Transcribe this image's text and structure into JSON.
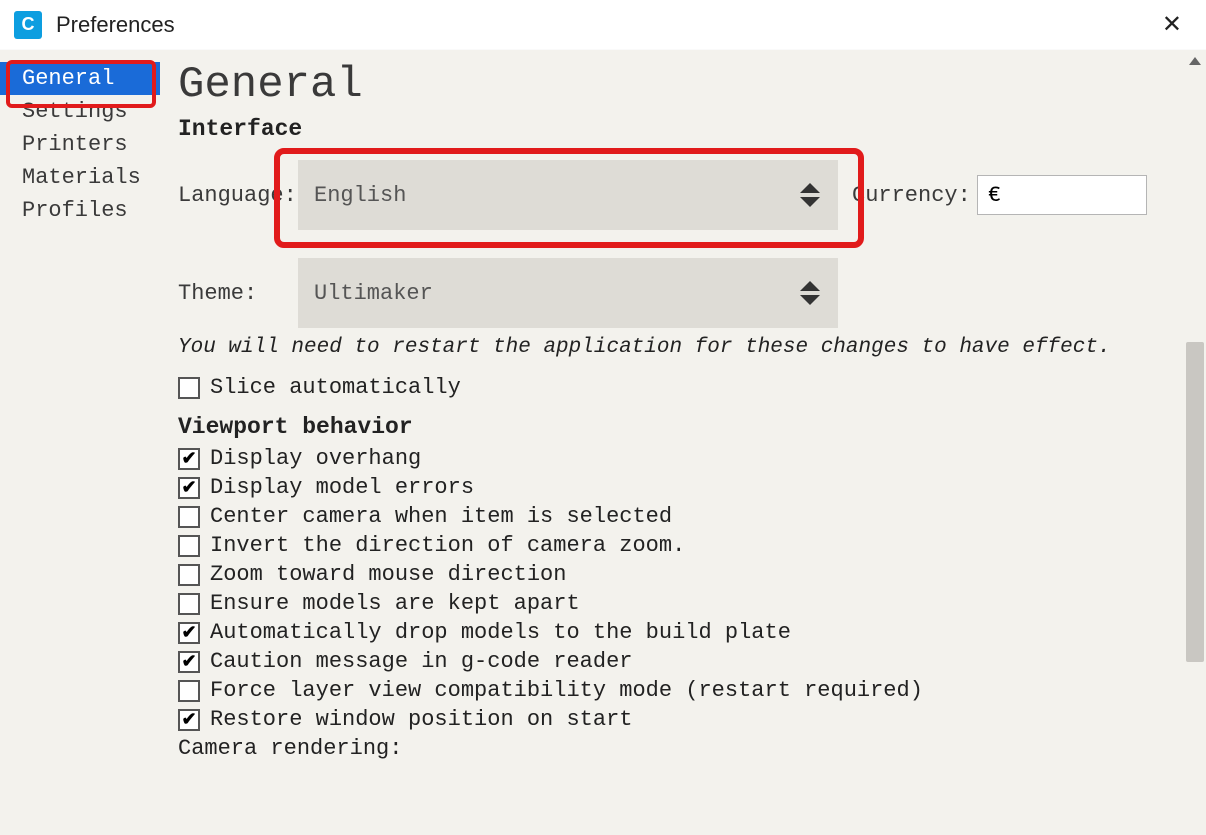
{
  "window": {
    "title": "Preferences"
  },
  "sidebar": {
    "items": [
      {
        "label": "General",
        "active": true
      },
      {
        "label": "Settings",
        "active": false
      },
      {
        "label": "Printers",
        "active": false
      },
      {
        "label": "Materials",
        "active": false
      },
      {
        "label": "Profiles",
        "active": false
      }
    ]
  },
  "main": {
    "page_title": "General",
    "sections": {
      "interface": {
        "heading": "Interface",
        "language_label": "Language:",
        "language_value": "English",
        "currency_label": "Currency:",
        "currency_value": "€",
        "theme_label": "Theme:",
        "theme_value": "Ultimaker",
        "restart_note": "You will need to restart the application for these changes to have effect.",
        "slice_auto": {
          "label": "Slice automatically",
          "checked": false
        }
      },
      "viewport": {
        "heading": "Viewport behavior",
        "items": [
          {
            "label": "Display overhang",
            "checked": true
          },
          {
            "label": "Display model errors",
            "checked": true
          },
          {
            "label": "Center camera when item is selected",
            "checked": false
          },
          {
            "label": "Invert the direction of camera zoom.",
            "checked": false
          },
          {
            "label": "Zoom toward mouse direction",
            "checked": false
          },
          {
            "label": "Ensure models are kept apart",
            "checked": false
          },
          {
            "label": "Automatically drop models to the build plate",
            "checked": true
          },
          {
            "label": "Caution message in g-code reader",
            "checked": true
          },
          {
            "label": "Force layer view compatibility mode (restart required)",
            "checked": false
          },
          {
            "label": "Restore window position on start",
            "checked": true
          }
        ],
        "camera_rendering_label": "Camera rendering:"
      }
    }
  }
}
